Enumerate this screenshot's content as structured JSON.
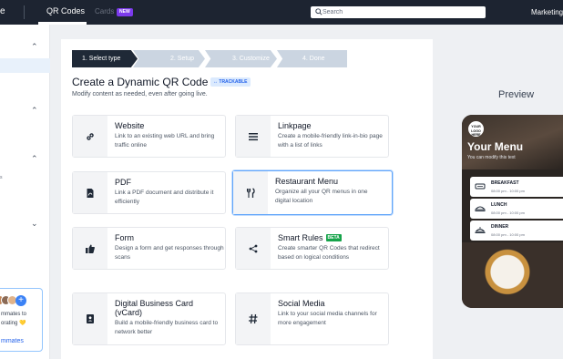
{
  "topbar": {
    "left_fragment": "e",
    "tabs": [
      {
        "label": "QR Codes",
        "active": true
      },
      {
        "label": "Cards",
        "badge": "NEW",
        "active": false
      }
    ],
    "search": {
      "placeholder": "Search",
      "value": ""
    },
    "right_fragment": "Marketing"
  },
  "sidebar": {
    "text_fragment": "s",
    "promo": {
      "line1": "mmates to",
      "line2": "orating 💛",
      "link": "mmates",
      "add_icon": "+"
    }
  },
  "stepper": [
    {
      "label": "1. Select type",
      "active": true
    },
    {
      "label": "2. Setup",
      "active": false
    },
    {
      "label": "3. Customize",
      "active": false
    },
    {
      "label": "4. Done",
      "active": false
    }
  ],
  "header": {
    "title": "Create a Dynamic QR Code",
    "badge": "↔ TRACKABLE",
    "subtitle": "Modify content as needed, even after going live."
  },
  "types": [
    {
      "title": "Website",
      "desc": "Link to an existing web URL and bring traffic online",
      "icon": "link-icon"
    },
    {
      "title": "Linkpage",
      "desc": "Create a mobile-friendly link-in-bio page with a list of links",
      "icon": "list-icon"
    },
    {
      "title": "PDF",
      "desc": "Link a PDF document and distribute it efficiently",
      "icon": "pdf-icon"
    },
    {
      "title": "Restaurant Menu",
      "desc": "Organize all your QR menus in one digital location",
      "icon": "fork-knife-icon",
      "selected": true
    },
    {
      "title": "Form",
      "desc": "Design a form and get responses through scans",
      "icon": "thumbs-up-icon"
    },
    {
      "title": "Smart Rules",
      "badge": "BETA",
      "desc": "Create smarter QR Codes that redirect based on logical conditions",
      "icon": "share-nodes-icon"
    },
    {
      "title": "Digital Business Card (vCard)",
      "desc": "Build a mobile-friendly business card to network better",
      "icon": "contact-card-icon"
    },
    {
      "title": "Social Media",
      "desc": "Link to your social media channels for more engagement",
      "icon": "hashtag-icon"
    }
  ],
  "preview": {
    "label": "Preview",
    "logo": "YOUR LOGO HERE",
    "heading": "Your Menu",
    "subheading": "You can modify this text",
    "menus": [
      {
        "title": "BREAKFAST",
        "time": "08:00 pm - 10:00 pm",
        "icon": "breakfast-icon"
      },
      {
        "title": "LUNCH",
        "time": "08:00 pm - 10:00 pm",
        "icon": "lunch-icon"
      },
      {
        "title": "DINNER",
        "time": "08:00 pm - 10:00 pm",
        "icon": "dinner-icon"
      }
    ]
  },
  "colors": {
    "topbar_bg": "#1d2431",
    "accent": "#3b82f6",
    "new_badge": "#7c3aed",
    "beta_badge": "#16a34a",
    "stepper_active": "#1f2937",
    "stepper_inactive": "#cbd5e1"
  }
}
